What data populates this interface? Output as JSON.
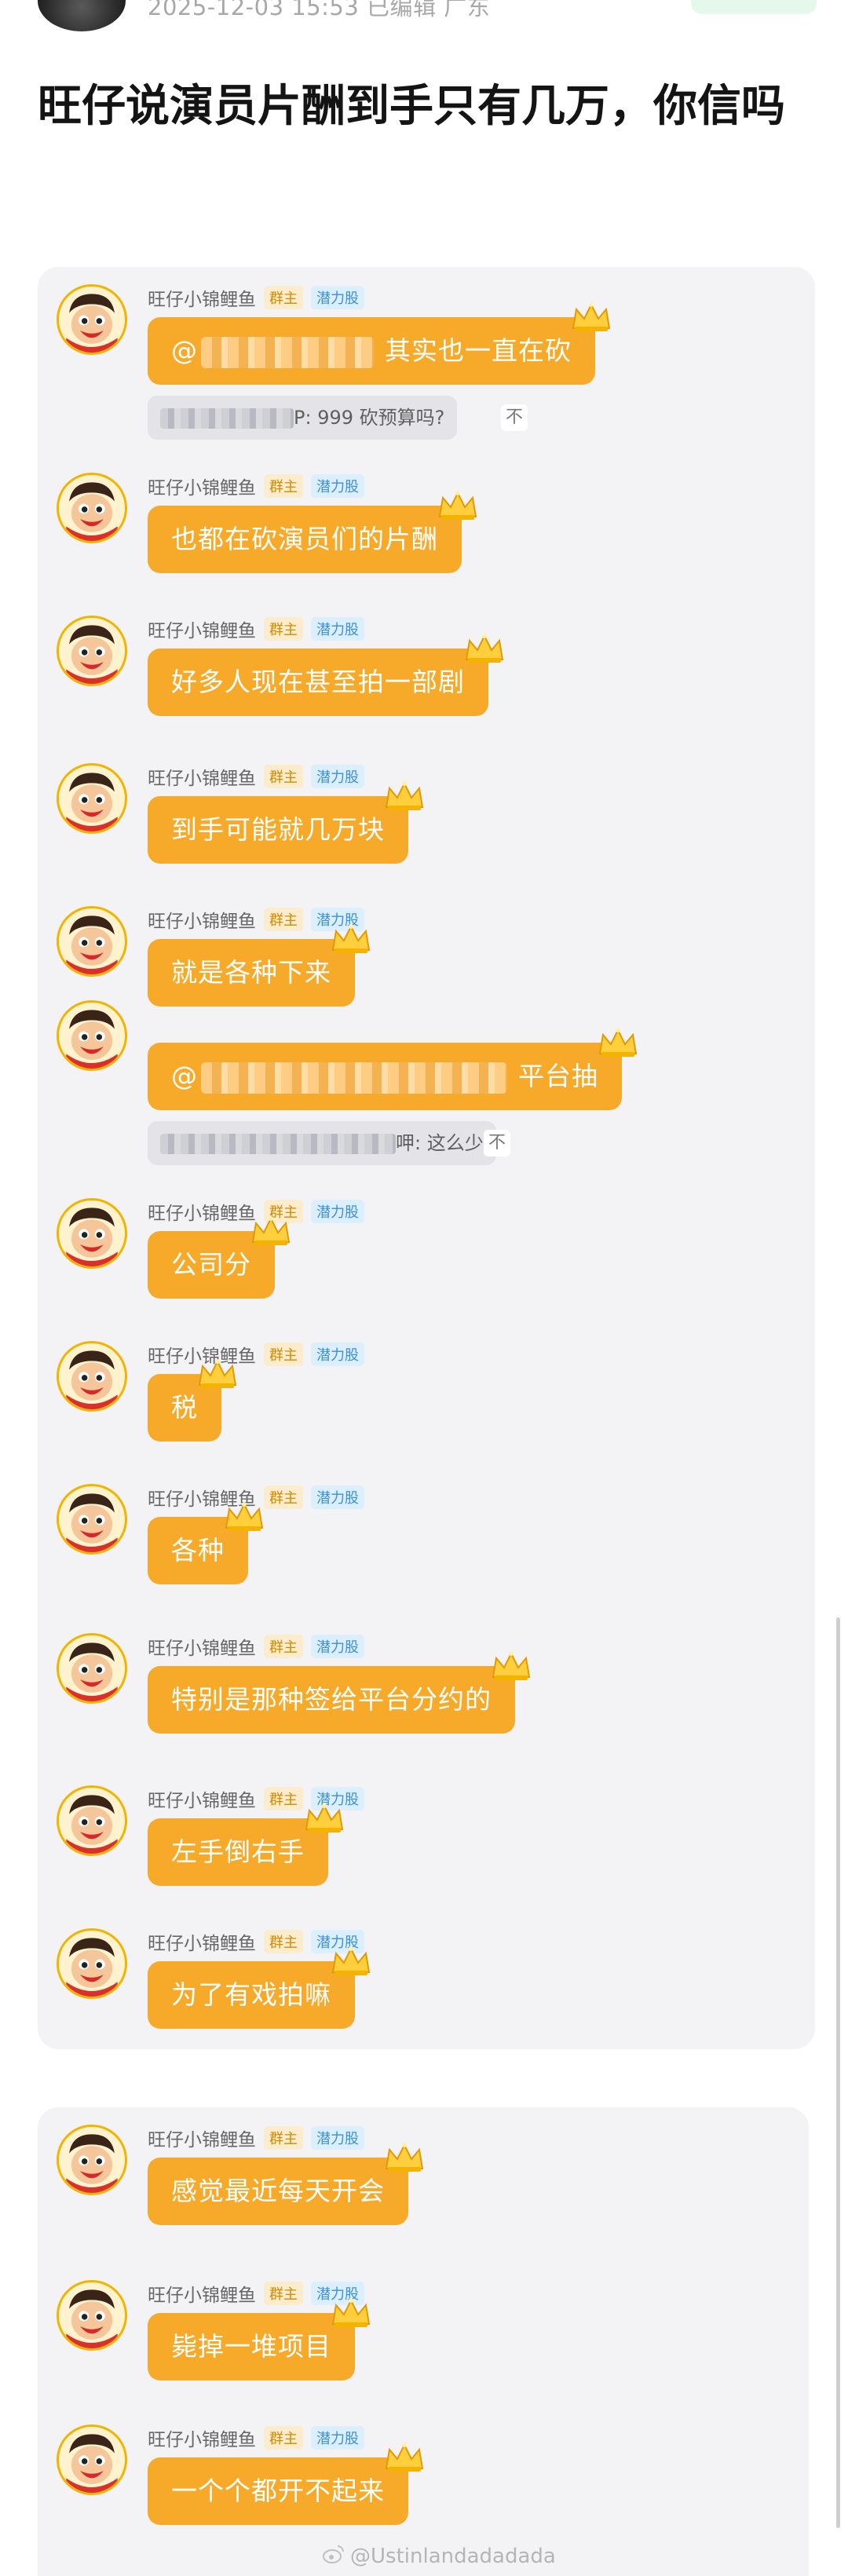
{
  "post": {
    "meta": "2025-12-03 15:53  已编辑  广东",
    "title": "旺仔说演员片酬到手只有几万，你信吗"
  },
  "chat": {
    "sender": "旺仔小锦鲤鱼",
    "tag_owner": "群主",
    "tag_potential": "潜力股",
    "mention_prefix": "@",
    "messages": [
      {
        "text": "其实也一直在砍"
      },
      {
        "text": "也都在砍演员们的片酬"
      },
      {
        "text": "好多人现在甚至拍一部剧"
      },
      {
        "text": "到手可能就几万块"
      },
      {
        "text": "就是各种下来"
      },
      {
        "text": "平台抽"
      },
      {
        "text": "公司分"
      },
      {
        "text": "税"
      },
      {
        "text": "各种"
      },
      {
        "text": "特别是那种签给平台分约的"
      },
      {
        "text": "左手倒右手"
      },
      {
        "text": "为了有戏拍嘛"
      },
      {
        "text": "感觉最近每天开会"
      },
      {
        "text": "毙掉一堆项目"
      },
      {
        "text": "一个个都开不起来"
      }
    ],
    "quotes": [
      {
        "text": "P: 999 砍预算吗?",
        "close": "不"
      },
      {
        "text": "呷: 这么少",
        "close": "不"
      }
    ]
  },
  "watermark": "@Ustinlandadadada",
  "colors": {
    "bubble": "#f7a929",
    "card_bg": "#f3f3f5",
    "tag_owner": "#d48a00",
    "tag_potential": "#3b8fde"
  },
  "icons": [
    "avatar-icon",
    "crown-icon",
    "weibo-icon"
  ]
}
